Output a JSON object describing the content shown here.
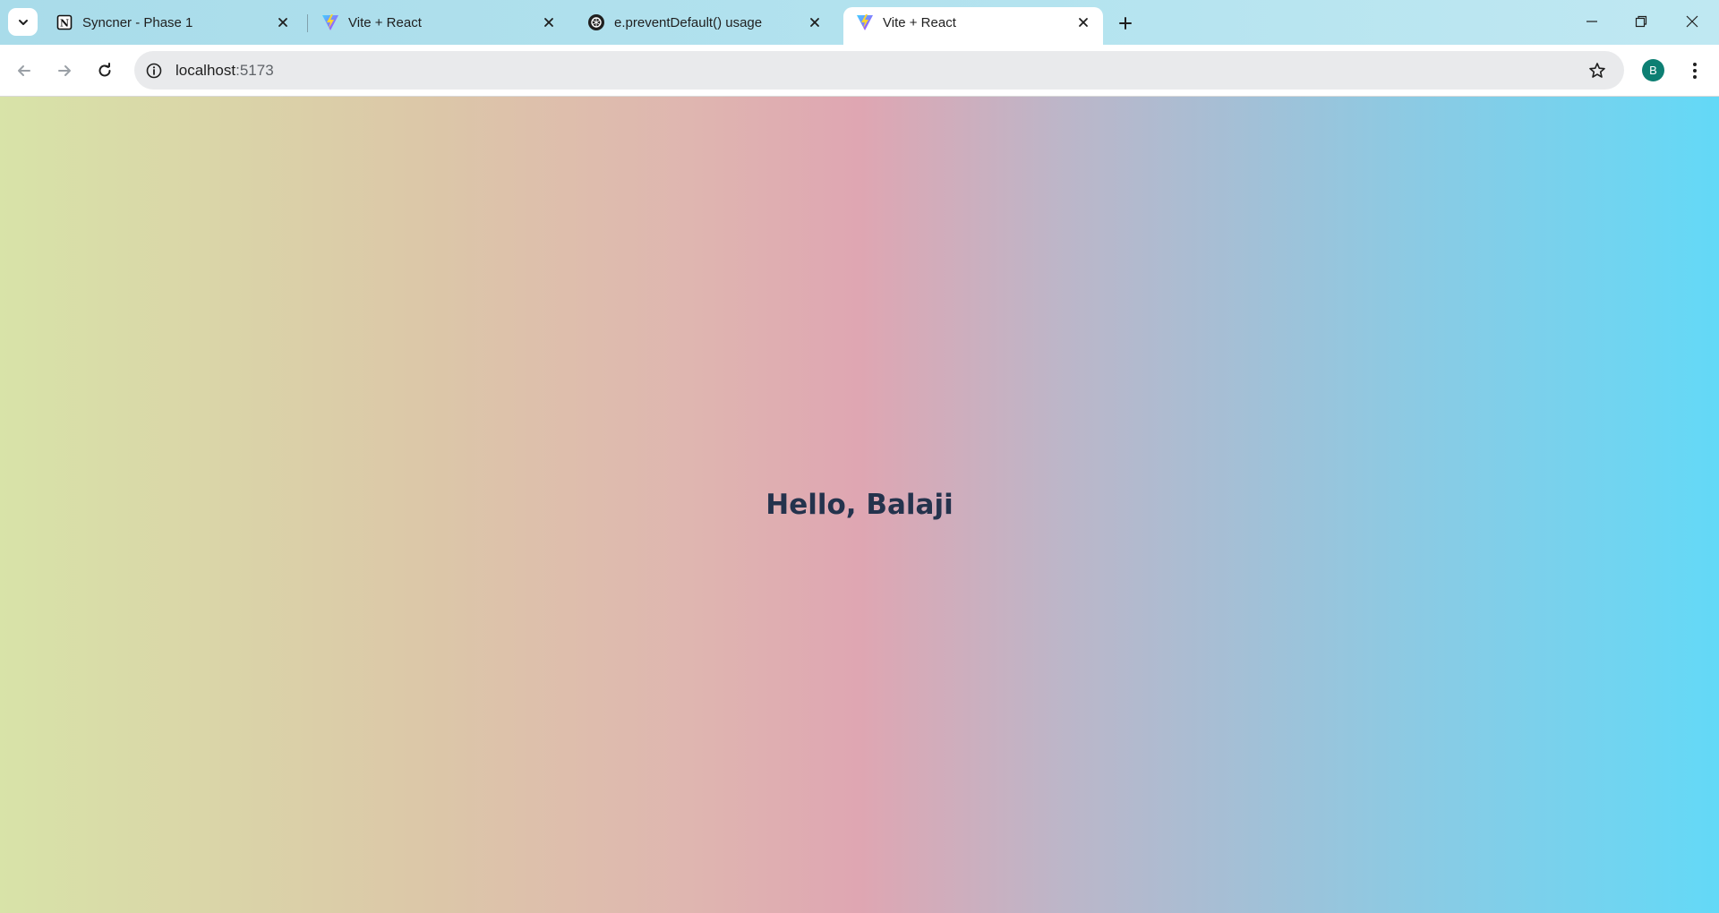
{
  "browser": {
    "tabs": [
      {
        "title": "Syncner - Phase 1",
        "icon": "notion-icon"
      },
      {
        "title": "Vite + React",
        "icon": "vite-icon"
      },
      {
        "title": "e.preventDefault() usage",
        "icon": "openai-icon"
      },
      {
        "title": "Vite + React",
        "icon": "vite-icon",
        "active": true
      }
    ],
    "address": {
      "host": "localhost",
      "port": ":5173"
    },
    "profile_initial": "B"
  },
  "page": {
    "greeting": "Hello, Balaji"
  }
}
